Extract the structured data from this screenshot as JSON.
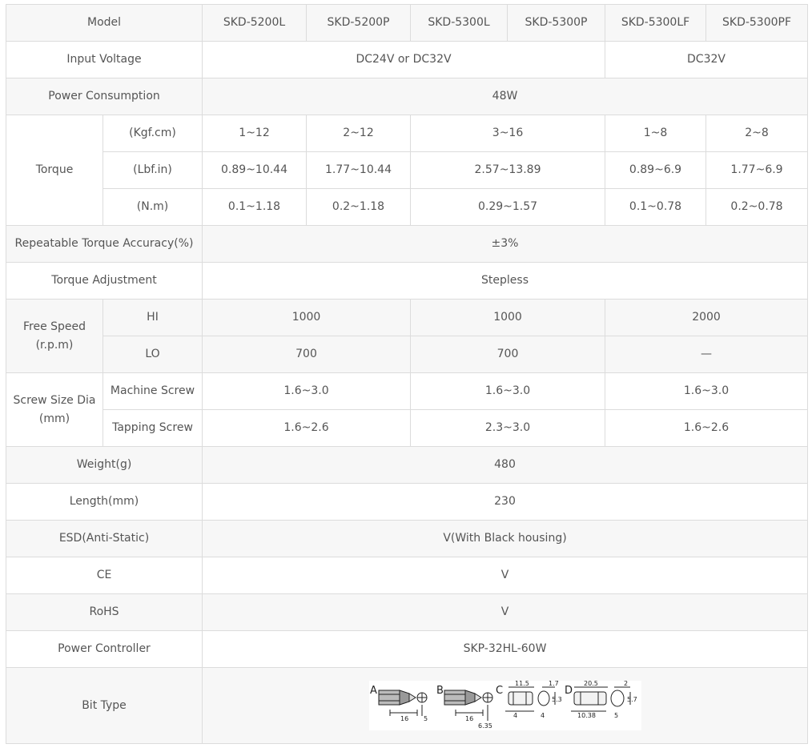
{
  "header": {
    "label": "Model",
    "models": [
      "SKD-5200L",
      "SKD-5200P",
      "SKD-5300L",
      "SKD-5300P",
      "SKD-5300LF",
      "SKD-5300PF"
    ]
  },
  "input_voltage": {
    "label": "Input Voltage",
    "group1": "DC24V or DC32V",
    "group2": "DC32V"
  },
  "power_consumption": {
    "label": "Power Consumption",
    "value": "48W"
  },
  "torque": {
    "label": "Torque",
    "rows": [
      {
        "unit": "(Kgf.cm)",
        "values": [
          "1~12",
          "2~12",
          "3~16",
          "1~8",
          "2~8"
        ]
      },
      {
        "unit": "(Lbf.in)",
        "values": [
          "0.89~10.44",
          "1.77~10.44",
          "2.57~13.89",
          "0.89~6.9",
          "1.77~6.9"
        ]
      },
      {
        "unit": "(N.m)",
        "values": [
          "0.1~1.18",
          "0.2~1.18",
          "0.29~1.57",
          "0.1~0.78",
          "0.2~0.78"
        ]
      }
    ]
  },
  "repeatable_accuracy": {
    "label": "Repeatable Torque Accuracy(%)",
    "value": "±3%"
  },
  "torque_adjustment": {
    "label": "Torque Adjustment",
    "value": "Stepless"
  },
  "free_speed": {
    "label_line1": "Free Speed",
    "label_line2": "(r.p.m)",
    "rows": [
      {
        "sub": "HI",
        "values": [
          "1000",
          "1000",
          "2000"
        ]
      },
      {
        "sub": "LO",
        "values": [
          "700",
          "700",
          "—"
        ]
      }
    ]
  },
  "screw_size": {
    "label_line1": "Screw Size Dia",
    "label_line2": "(mm)",
    "rows": [
      {
        "sub": "Machine Screw",
        "values": [
          "1.6~3.0",
          "1.6~3.0",
          "1.6~3.0"
        ]
      },
      {
        "sub": "Tapping Screw",
        "values": [
          "1.6~2.6",
          "2.3~3.0",
          "1.6~2.6"
        ]
      }
    ]
  },
  "weight": {
    "label": "Weight(g)",
    "value": "480"
  },
  "length": {
    "label": "Length(mm)",
    "value": "230"
  },
  "esd": {
    "label": "ESD(Anti-Static)",
    "value": "V(With Black housing)"
  },
  "ce": {
    "label": "CE",
    "value": "V"
  },
  "rohs": {
    "label": "RoHS",
    "value": "V"
  },
  "power_controller": {
    "label": "Power Controller",
    "value": "SKP-32HL-60W"
  },
  "bit_type": {
    "label": "Bit Type",
    "letters": [
      "A",
      "B",
      "C",
      "D"
    ],
    "dims": {
      "a_len": "16",
      "a_dia": "5",
      "b_len": "16",
      "b_dia": "6.35",
      "c_top": "11.5",
      "c_top2": "1.7",
      "c_bot": "4",
      "c_side": "5.3",
      "c_bot2": "4",
      "d_top": "20.5",
      "d_top2": "2",
      "d_bot": "10.38",
      "d_side": "5.7",
      "d_bot2": "5"
    }
  }
}
